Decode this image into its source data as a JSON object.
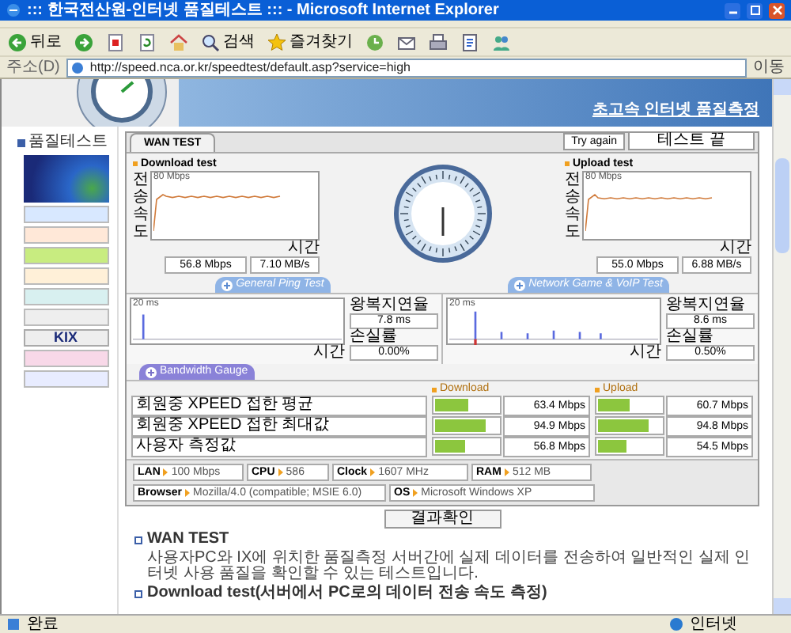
{
  "window": {
    "title": "::: 한국전산원-인터넷 품질테스트 ::: - Microsoft Internet Explorer"
  },
  "toolbar": {
    "buttons": [
      {
        "kind": "back",
        "label": "뒤로"
      },
      {
        "kind": "forward"
      },
      {
        "kind": "stop"
      },
      {
        "kind": "refresh"
      },
      {
        "kind": "home"
      },
      {
        "kind": "search",
        "label": "검색"
      },
      {
        "kind": "favorites",
        "label": "즐겨찾기"
      },
      {
        "kind": "history"
      },
      {
        "kind": "mail"
      },
      {
        "kind": "print"
      },
      {
        "kind": "edit"
      },
      {
        "kind": "messenger"
      }
    ]
  },
  "address_bar": {
    "label": "주소(D)",
    "url": "http://speed.nca.or.kr/speedtest/default.asp?service=high",
    "go": "이동"
  },
  "header": {
    "title": "초고속 인터넷 품질측정"
  },
  "sidebar": {
    "heading": "품질테스트",
    "banners": [
      {
        "kind": "photo"
      },
      {
        "kind": "plain"
      },
      {
        "kind": "plain"
      },
      {
        "kind": "plain"
      },
      {
        "kind": "plain"
      },
      {
        "kind": "plain"
      },
      {
        "kind": "plain"
      },
      {
        "kind": "text",
        "label": "KIX"
      },
      {
        "kind": "plain"
      },
      {
        "kind": "plain"
      }
    ]
  },
  "test_panel": {
    "tab": "WAN TEST",
    "retry_button": "Try again",
    "status_field": "테스트 끝",
    "tests": [
      {
        "title": "Download test",
        "y_label": "전송속도",
        "top_tick": "80 Mbps",
        "x_label": "시간",
        "rate": "56.8 Mbps",
        "bytes": "7.10 MB/s"
      },
      {
        "title": "Upload test",
        "y_label": "전송속도",
        "top_tick": "80 Mbps",
        "x_label": "시간",
        "rate": "55.0 Mbps",
        "bytes": "6.88 MB/s"
      }
    ],
    "ping_tabs": [
      "General Ping Test",
      "Network Game & VoIP Test"
    ],
    "ping": [
      {
        "top_tick": "20 ms",
        "x_label": "시간",
        "latency_label": "왕복지연율",
        "latency": "7.8 ms",
        "loss_label": "손실률",
        "loss": "0.00%"
      },
      {
        "top_tick": "20 ms",
        "x_label": "시간",
        "latency_label": "왕복지연율",
        "latency": "8.6 ms",
        "loss_label": "손실률",
        "loss": "0.50%"
      }
    ],
    "bandwidth_tab": "Bandwidth Gauge",
    "bandwidth": {
      "columns": [
        "Download",
        "Upload"
      ],
      "rows": [
        {
          "label": "회원중 XPEED 접한 평균",
          "download": {
            "level": 0.53,
            "value": "63.4 Mbps"
          },
          "upload": {
            "level": 0.51,
            "value": "60.7 Mbps"
          }
        },
        {
          "label": "회원중 XPEED 접한 최대값",
          "download": {
            "level": 0.79,
            "value": "94.9 Mbps"
          },
          "upload": {
            "level": 0.79,
            "value": "94.8 Mbps"
          }
        },
        {
          "label": "사용자 측정값",
          "download": {
            "level": 0.47,
            "value": "56.8 Mbps"
          },
          "upload": {
            "level": 0.45,
            "value": "54.5 Mbps"
          }
        }
      ]
    },
    "system_info": [
      {
        "label": "LAN",
        "value": "100 Mbps"
      },
      {
        "label": "CPU",
        "value": "586"
      },
      {
        "label": "Clock",
        "value": "1607 MHz"
      },
      {
        "label": "RAM",
        "value": "512 MB"
      },
      {
        "label": "Browser",
        "value": "Mozilla/4.0 (compatible; MSIE 6.0)"
      },
      {
        "label": "OS",
        "value": "Microsoft Windows XP"
      }
    ],
    "result_button": "결과확인"
  },
  "notes": [
    {
      "heading": "WAN TEST",
      "text": "사용자PC와 IX에 위치한 품질측정 서버간에 실제 데이터를 전송하여 일반적인 실제 인터넷 사용 품질을 확인할 수 있는 테스트입니다."
    },
    {
      "heading": "Download test(서버에서 PC로의 데이터 전송 속도 측정)"
    }
  ],
  "status_bar": {
    "text": "완료",
    "zone": "인터넷"
  }
}
